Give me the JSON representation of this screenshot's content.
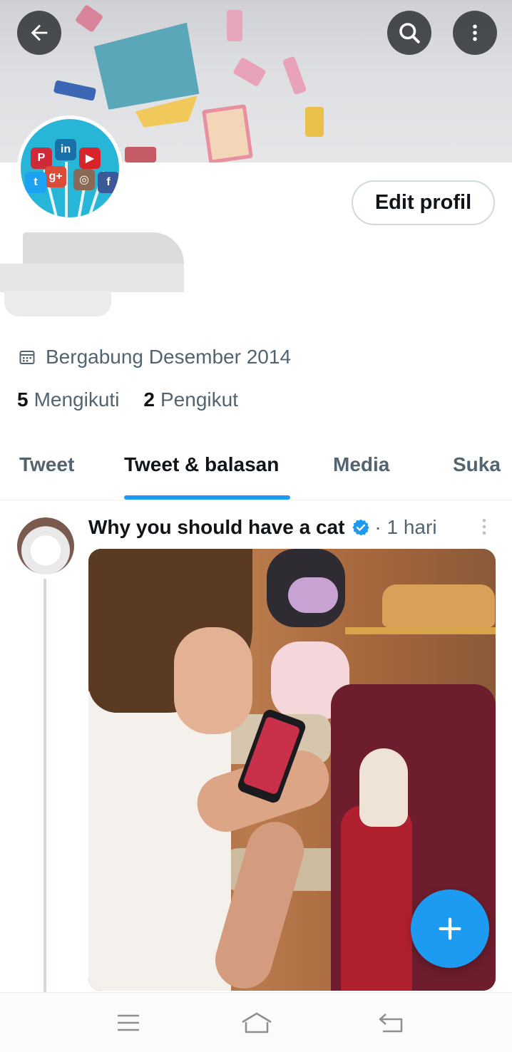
{
  "header": {
    "back_icon": "arrow-left-icon",
    "search_icon": "search-icon",
    "more_icon": "more-vertical-icon"
  },
  "profile": {
    "edit_button_label": "Edit profil",
    "joined_text": "Bergabung Desember 2014",
    "following_count": "5",
    "following_label": "Mengikuti",
    "followers_count": "2",
    "followers_label": "Pengikut"
  },
  "tabs": [
    {
      "label": "Tweet",
      "active": false
    },
    {
      "label": "Tweet & balasan",
      "active": true
    },
    {
      "label": "Media",
      "active": false
    },
    {
      "label": "Suka",
      "active": false
    }
  ],
  "tweet": {
    "author": "Why you should have a cat",
    "verified": true,
    "time": "· 1 hari"
  },
  "colors": {
    "accent": "#1d9bf0",
    "text_primary": "#0f1419",
    "text_secondary": "#536471"
  },
  "navbar": {
    "icons": [
      "menu-icon",
      "home-icon",
      "back-icon"
    ]
  }
}
